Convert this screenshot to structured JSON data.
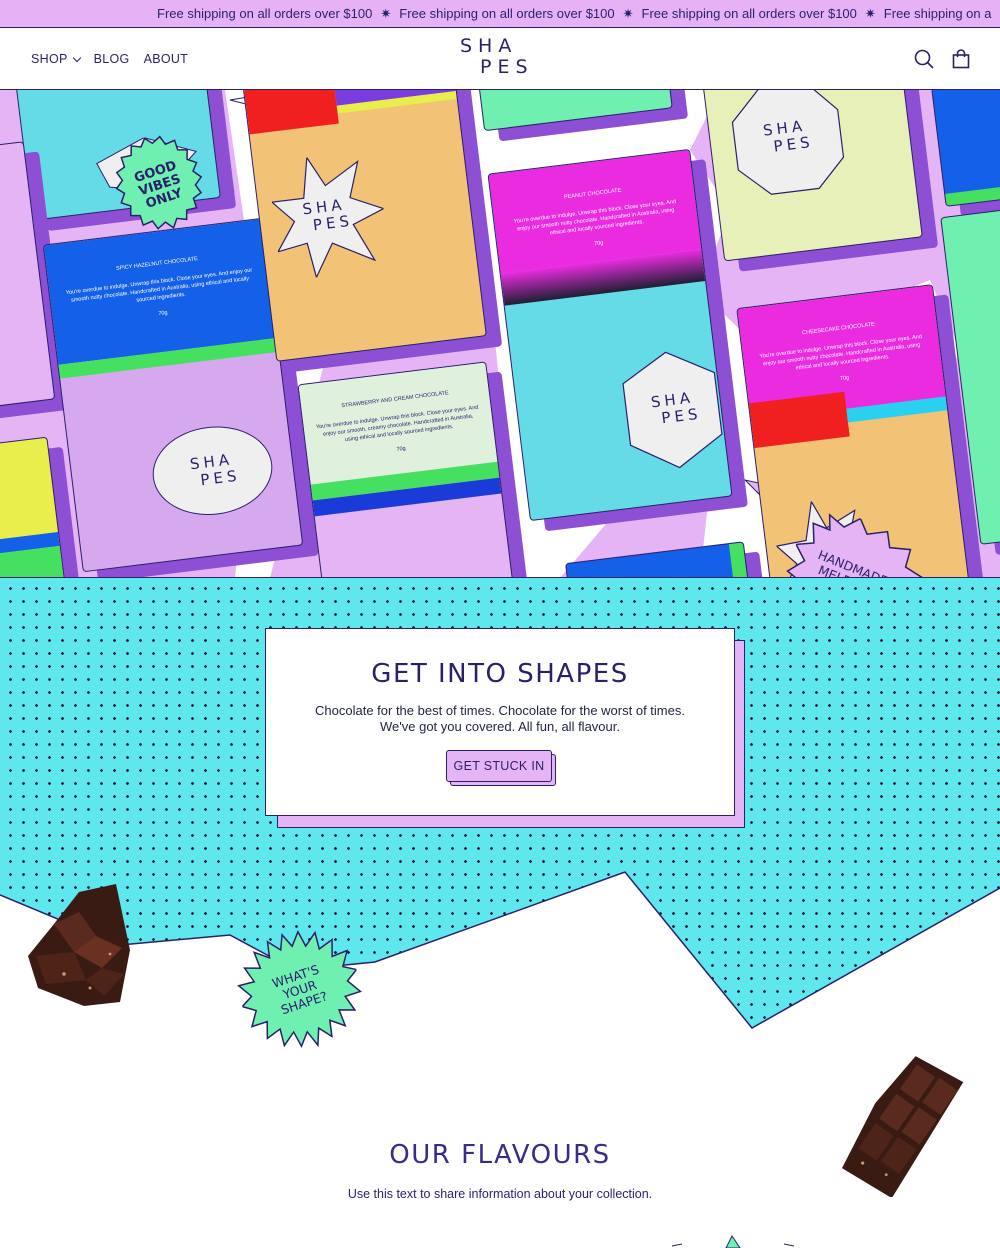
{
  "announcement": {
    "messages": [
      "Free shipping on all orders over $100",
      "Free shipping on all orders over $100",
      "Free shipping on all orders over $100",
      "Free shipping on a"
    ]
  },
  "header": {
    "nav": {
      "shop": "SHOP",
      "blog": "BLOG",
      "about": "ABOUT"
    },
    "logo": {
      "line1": "SHA",
      "line2": "PES"
    }
  },
  "hero": {
    "bars": {
      "spicy": {
        "name": "SPICY HAZELNUT CHOCOLATE",
        "desc": "You're overdue to indulge. Unwrap this block. Close your eyes. And enjoy our smooth nutty chocolate. Handcrafted in Australia, using ethical and locally sourced ingredients.",
        "weight": "70g"
      },
      "peanut": {
        "name": "PEANUT CHOCOLATE",
        "desc": "You're overdue to indulge. Unwrap this block. Close your eyes. And enjoy our smooth nutty chocolate. Handcrafted in Australia, using ethical and locally sourced ingredients.",
        "weight": "70g"
      },
      "strawberry": {
        "name": "STRAWBERRY AND CREAM CHOCOLATE",
        "desc": "You're overdue to indulge. Unwrap this block. Close your eyes. And enjoy our smooth, creamy chocolate. Handcrafted in Australia, using ethical and locally sourced ingredients.",
        "weight": "70g"
      },
      "cheesecake": {
        "name": "CHEESECAKE CHOCOLATE",
        "desc": "You're overdue to indulge. Unwrap this block. Close your eyes. And enjoy our smooth nutty chocolate. Handcrafted in Australia, using ethical and locally sourced ingredients.",
        "weight": "70g"
      }
    },
    "logo_stamp": {
      "line1": "SHA",
      "line2": "PES"
    },
    "sticker_good_vibes": {
      "l1": "GOOD",
      "l2": "VIBES",
      "l3": "ONLY"
    },
    "sticker_handmade": {
      "l1": "HANDMADE IN",
      "l2": "MELBOURNE"
    },
    "partial_letter": "S"
  },
  "promo": {
    "title": "GET INTO SHAPES",
    "body_line1": "Chocolate for the best of times. Chocolate for the worst of times.",
    "body_line2": "We've got you covered. All fun, all flavour.",
    "button": "GET STUCK IN"
  },
  "sticker_shape": {
    "l1": "WHAT'S",
    "l2": "YOUR",
    "l3": "SHAPE?"
  },
  "collection": {
    "title": "OUR FLAVOURS",
    "subtitle": "Use this text to share information about your collection."
  },
  "colors": {
    "ink": "#2a1f6b",
    "lilac": "#e5b4f5",
    "cyan": "#5ee8ee",
    "purple_shadow": "#8d4fd3",
    "mint": "#6ff0b0"
  },
  "icons": [
    "search-icon",
    "bag-icon",
    "chevron-down-icon",
    "sparkle-icon"
  ]
}
